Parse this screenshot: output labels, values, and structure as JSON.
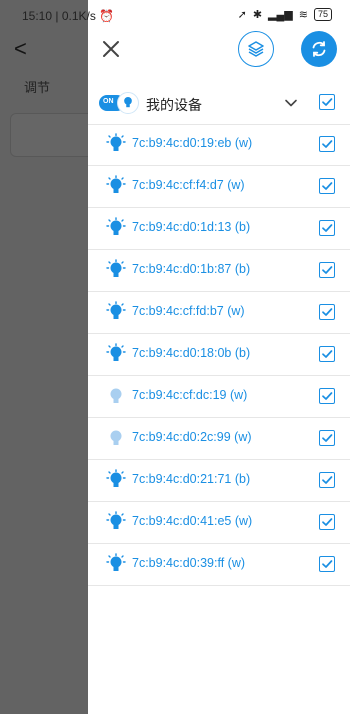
{
  "status_bar": {
    "time": "15:10",
    "network_speed": "0.1K/s",
    "battery": "75"
  },
  "background": {
    "back_glyph": "<",
    "section_label": "调节"
  },
  "drawer": {
    "group": {
      "toggle_label": "ON",
      "name": "我的设备",
      "checked": true
    },
    "devices": [
      {
        "name": "7c:b9:4c:d0:19:eb (w)",
        "online": true,
        "checked": true
      },
      {
        "name": "7c:b9:4c:cf:f4:d7 (w)",
        "online": true,
        "checked": true
      },
      {
        "name": "7c:b9:4c:d0:1d:13 (b)",
        "online": true,
        "checked": true
      },
      {
        "name": "7c:b9:4c:d0:1b:87 (b)",
        "online": true,
        "checked": true
      },
      {
        "name": "7c:b9:4c:cf:fd:b7 (w)",
        "online": true,
        "checked": true
      },
      {
        "name": "7c:b9:4c:d0:18:0b (b)",
        "online": true,
        "checked": true
      },
      {
        "name": "7c:b9:4c:cf:dc:19 (w)",
        "online": false,
        "checked": true
      },
      {
        "name": "7c:b9:4c:d0:2c:99 (w)",
        "online": false,
        "checked": true
      },
      {
        "name": "7c:b9:4c:d0:21:71 (b)",
        "online": true,
        "checked": true
      },
      {
        "name": "7c:b9:4c:d0:41:e5 (w)",
        "online": true,
        "checked": true
      },
      {
        "name": "7c:b9:4c:d0:39:ff (w)",
        "online": true,
        "checked": true
      }
    ]
  },
  "colors": {
    "accent": "#1a8fe3",
    "bulb_on": "#1a8fe3",
    "bulb_off": "#a9cff0"
  },
  "icons": {
    "close": "close-icon",
    "layers": "layers-icon",
    "sync": "sync-icon",
    "bulb": "bulb-icon",
    "chevron": "chevron-down-icon",
    "checkbox": "checkbox-icon"
  }
}
